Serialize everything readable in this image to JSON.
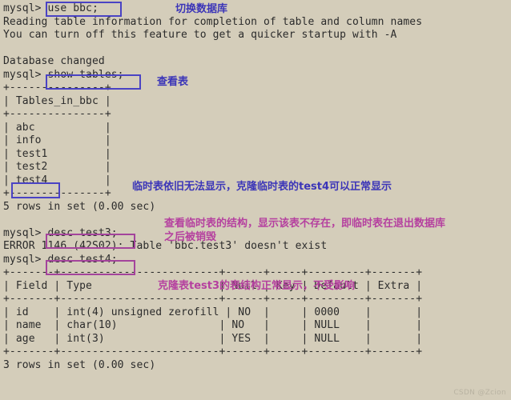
{
  "terminal": {
    "background_color": "#d4cdba",
    "text_color": "#2b2b2b",
    "lines": [
      "mysql> use bbc;",
      "Reading table information for completion of table and column names",
      "You can turn off this feature to get a quicker startup with -A",
      "",
      "Database changed",
      "mysql> show tables;",
      "+---------------+",
      "| Tables_in_bbc |",
      "+---------------+",
      "| abc           |",
      "| info          |",
      "| test1         |",
      "| test2         |",
      "| test4         |",
      "+---------------+",
      "5 rows in set (0.00 sec)",
      "",
      "mysql> desc test3;",
      "ERROR 1146 (42S02): Table 'bbc.test3' doesn't exist",
      "mysql> desc test4;",
      "+-------+-------------------------+------+-----+---------+-------+",
      "| Field | Type                    | Null | Key | Default | Extra |",
      "+-------+-------------------------+------+-----+---------+-------+",
      "| id    | int(4) unsigned zerofill | NO  |     | 0000    |       |",
      "| name  | char(10)                | NO   |     | NULL    |       |",
      "| age   | int(3)                  | YES  |     | NULL    |       |",
      "+-------+-------------------------+------+-----+---------+-------+",
      "3 rows in set (0.00 sec)"
    ]
  },
  "commands": {
    "use_database": "use bbc;",
    "show_tables": "show tables;",
    "desc_test3": "desc test3;",
    "desc_test4": "desc test4;",
    "highlighted_table_row": "test4"
  },
  "tables_result": {
    "header": "Tables_in_bbc",
    "rows": [
      "abc",
      "info",
      "test1",
      "test2",
      "test4"
    ],
    "footer": "5 rows in set (0.00 sec)"
  },
  "desc_result": {
    "columns": [
      "Field",
      "Type",
      "Null",
      "Key",
      "Default",
      "Extra"
    ],
    "rows": [
      {
        "field": "id",
        "type": "int(4) unsigned zerofill",
        "null": "NO",
        "key": "",
        "default": "0000",
        "extra": ""
      },
      {
        "field": "name",
        "type": "char(10)",
        "null": "NO",
        "key": "",
        "default": "NULL",
        "extra": ""
      },
      {
        "field": "age",
        "type": "int(3)",
        "null": "YES",
        "key": "",
        "default": "NULL",
        "extra": ""
      }
    ],
    "footer": "3 rows in set (0.00 sec)"
  },
  "messages": {
    "reading_info": "Reading table information for completion of table and column names",
    "turn_off_hint": "You can turn off this feature to get a quicker startup with -A",
    "database_changed": "Database changed",
    "error_test3": "ERROR 1146 (42S02): Table 'bbc.test3' doesn't exist"
  },
  "annotations": {
    "switch_database": "切换数据库",
    "view_tables": "查看表",
    "temp_table_note": "临时表依旧无法显示，克隆临时表的test4可以正常显示",
    "temp_structure_note": "查看临时表的结构，显示该表不存在，即临时表在退出数据库\n之后被销毁",
    "clone_structure_note": "克隆表test3的表结构正常显示，不受影响"
  },
  "colors": {
    "annotation_blue": "#3b35b8",
    "annotation_purple": "#b5409f",
    "box_blue": "#4a43c4",
    "box_purple": "#a4449c"
  },
  "watermark": "CSDN @Zcion"
}
